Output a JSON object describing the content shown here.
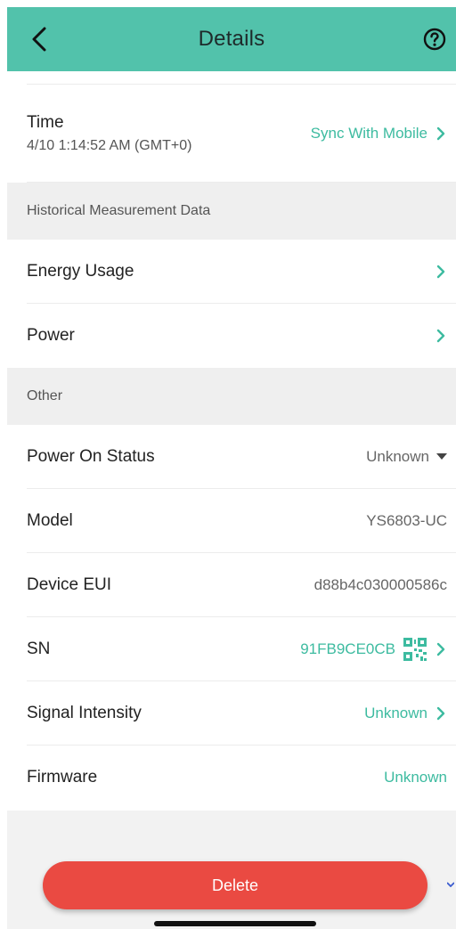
{
  "header": {
    "title": "Details"
  },
  "time": {
    "label": "Time",
    "value": "4/10 1:14:52 AM (GMT+0)",
    "action": "Sync With Mobile"
  },
  "sections": {
    "historical": "Historical Measurement Data",
    "other": "Other"
  },
  "historical_items": [
    {
      "label": "Energy Usage"
    },
    {
      "label": "Power"
    }
  ],
  "other_items": {
    "power_on_status": {
      "label": "Power On Status",
      "value": "Unknown"
    },
    "model": {
      "label": "Model",
      "value": "YS6803-UC"
    },
    "device_eui": {
      "label": "Device EUI",
      "value": "d88b4c030000586c"
    },
    "sn": {
      "label": "SN",
      "value": "91FB9CE0CB"
    },
    "signal": {
      "label": "Signal Intensity",
      "value": "Unknown"
    },
    "firmware": {
      "label": "Firmware",
      "value": "Unknown"
    }
  },
  "delete_label": "Delete",
  "colors": {
    "accent": "#52c2ab",
    "link": "#3dbba0",
    "danger": "#ea4a42"
  },
  "icons": [
    "back-arrow-icon",
    "help-circle-icon",
    "chevron-right-icon",
    "dropdown-caret-icon",
    "qr-code-icon"
  ]
}
